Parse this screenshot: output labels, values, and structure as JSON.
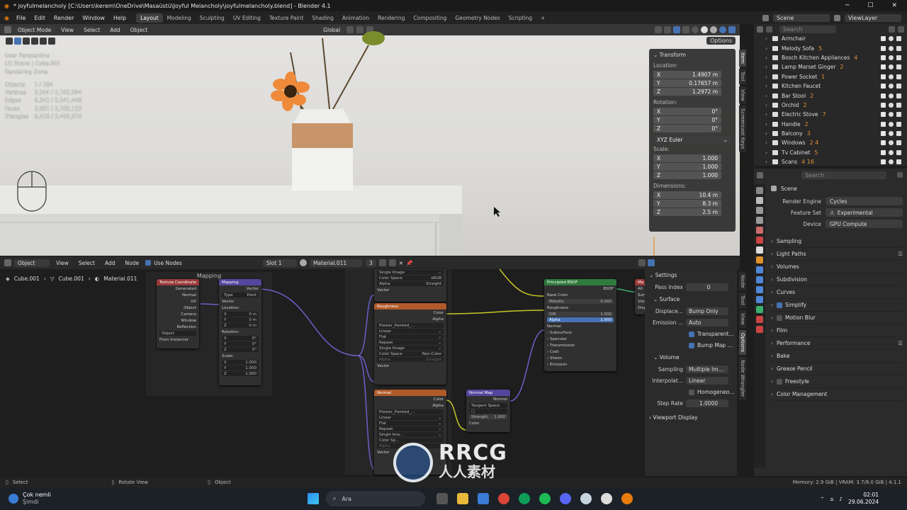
{
  "titlebar": {
    "title": "* joyfulmelancholy [C:\\Users\\kerem\\OneDrive\\Masaüstü\\Joyful Melancholy\\joyfulmelancholy.blend] - Blender 4.1"
  },
  "menubar": {
    "menus": [
      "File",
      "Edit",
      "Render",
      "Window",
      "Help"
    ],
    "workspaces": [
      "Layout",
      "Modeling",
      "Sculpting",
      "UV Editing",
      "Texture Paint",
      "Shading",
      "Animation",
      "Rendering",
      "Compositing",
      "Geometry Nodes",
      "Scripting"
    ],
    "active_workspace": "Layout",
    "add_tab": "+",
    "scene": "Scene",
    "view_layer": "ViewLayer"
  },
  "viewport": {
    "mode": "Object Mode",
    "menus": [
      "View",
      "Select",
      "Add",
      "Object"
    ],
    "orientation": "Global",
    "options": "Options",
    "info": {
      "perspective": "User Perspective",
      "collection": "(2) Scans | Cube.001",
      "status": "Rendering Done"
    },
    "stats": [
      {
        "label": "Objects",
        "value": "1 / 184"
      },
      {
        "label": "Vertices",
        "value": "3,244 / 2,782,094"
      },
      {
        "label": "Edges",
        "value": "6,342 / 5,541,448"
      },
      {
        "label": "Faces",
        "value": "3,097 / 2,765,125"
      },
      {
        "label": "Triangles",
        "value": "6,416 / 5,495,970"
      }
    ]
  },
  "npanel": {
    "title": "Transform",
    "location_label": "Location:",
    "location": [
      {
        "axis": "X",
        "value": "1.4907 m"
      },
      {
        "axis": "Y",
        "value": "0.17657 m"
      },
      {
        "axis": "Z",
        "value": "1.2972 m"
      }
    ],
    "rotation_label": "Rotation:",
    "rotation": [
      {
        "axis": "X",
        "value": "0°"
      },
      {
        "axis": "Y",
        "value": "0°"
      },
      {
        "axis": "Z",
        "value": "0°"
      }
    ],
    "rotation_mode": "XYZ Euler",
    "scale_label": "Scale:",
    "scale": [
      {
        "axis": "X",
        "value": "1.000"
      },
      {
        "axis": "Y",
        "value": "1.000"
      },
      {
        "axis": "Z",
        "value": "1.000"
      }
    ],
    "dimensions_label": "Dimensions:",
    "dimensions": [
      {
        "axis": "X",
        "value": "10.4 m"
      },
      {
        "axis": "Y",
        "value": "8.3 m"
      },
      {
        "axis": "Z",
        "value": "2.5 m"
      }
    ],
    "tabs": [
      "Item",
      "Tool",
      "View",
      "Screencast Keys"
    ]
  },
  "outliner": {
    "search_placeholder": "Search",
    "items": [
      {
        "name": "Armchair"
      },
      {
        "name": "Melody Sofa",
        "badge": "5"
      },
      {
        "name": "Bosch Kitchen Appliances",
        "badge": "4"
      },
      {
        "name": "Lamp Marset Ginger",
        "badge": "2"
      },
      {
        "name": "Power Socket",
        "badge": "1"
      },
      {
        "name": "Kitchen Faucet",
        "badge": ""
      },
      {
        "name": "Bar Stool",
        "badge": "2"
      },
      {
        "name": "Orchid",
        "badge": "2"
      },
      {
        "name": "Electric Stove",
        "badge": "7"
      },
      {
        "name": "Handle",
        "badge": "2"
      },
      {
        "name": "Balcony",
        "badge": "3"
      },
      {
        "name": "Windows",
        "badge": "2 4"
      },
      {
        "name": "Tv Cabinet",
        "badge": "5"
      },
      {
        "name": "Scans",
        "badge": "4 16"
      }
    ]
  },
  "properties": {
    "search_placeholder": "Search",
    "context": "Scene",
    "render_engine_label": "Render Engine",
    "render_engine": "Cycles",
    "feature_set_label": "Feature Set",
    "feature_set": "Experimental",
    "device_label": "Device",
    "device": "GPU Compute",
    "sections": [
      "Sampling",
      "Light Paths",
      "Volumes",
      "Subdivision",
      "Curves",
      "Simplify",
      "Motion Blur",
      "Film",
      "Performance",
      "Bake",
      "Grease Pencil",
      "Freestyle",
      "Color Management"
    ]
  },
  "node_editor": {
    "mode": "Object",
    "menus": [
      "View",
      "Select",
      "Add",
      "Node"
    ],
    "use_nodes": "Use Nodes",
    "slot": "Slot 1",
    "material": "Material.011",
    "users": "3",
    "breadcrumb": [
      "Cube.001",
      "Cube.001",
      "Material.011"
    ],
    "frame_label": "Mapping",
    "nodes": {
      "texcoord": {
        "title": "Texture Coordinate",
        "outputs": [
          "Generated",
          "Normal",
          "UV",
          "Object",
          "Camera",
          "Window",
          "Reflection"
        ],
        "object_label": "Object",
        "from_instancer": "From Instancer"
      },
      "mapping": {
        "title": "Mapping",
        "out": "Vector",
        "type_label": "Type",
        "type": "Point",
        "vector": "Vector",
        "location": "Location:",
        "loc": [
          "0 m",
          "0 m",
          "0 m"
        ],
        "rotation": "Rotation:",
        "rot": [
          "0°",
          "0°",
          "0°"
        ],
        "scale": "Scale:",
        "scl": [
          "1.000",
          "1.000",
          "1.000"
        ]
      },
      "img_top": {
        "rows": [
          "Single Image",
          "Color Space",
          "sRGB",
          "Alpha",
          "Straight",
          "Vector"
        ]
      },
      "roughness": {
        "title": "Roughness",
        "color": "Color",
        "alpha": "Alpha",
        "image": "Plaster_Painted_...",
        "interp": "Linear",
        "proj": "Flat",
        "ext": "Repeat",
        "source": "Single Image",
        "cs_label": "Color Space",
        "cs": "Non-Color",
        "alpha_label": "Alpha",
        "alpha_val": "Straight",
        "vector": "Vector"
      },
      "normal": {
        "title": "Normal",
        "color": "Color",
        "alpha": "Alpha",
        "image": "Plaster_Painted_...",
        "interp": "Linear",
        "proj": "Flat",
        "ext": "Repeat",
        "source": "Single Ima...",
        "cs_label": "Color Sp...",
        "alpha_label": "Alpha",
        "vector": "Vector"
      },
      "normalmap": {
        "title": "Normal Map",
        "out": "Normal",
        "space": "Tangent Space",
        "strength_label": "Strength",
        "strength": "1.000",
        "color": "Color"
      },
      "bsdf": {
        "title": "Principled BSDF",
        "out": "BSDF",
        "base_color": "Base Color",
        "metallic": "Metallic",
        "metallic_val": "0.000",
        "roughness": "Roughness",
        "ior": "IOR",
        "ior_val": "1.500",
        "alpha": "Alpha",
        "alpha_val": "1.000",
        "normal": "Normal",
        "subs": [
          "Subsurface",
          "Specular",
          "Transmission",
          "Coat",
          "Sheen",
          "Emission"
        ]
      },
      "output": {
        "title": "Ma",
        "rows": [
          "All",
          "Surfa",
          "Volu",
          "Displ"
        ]
      }
    }
  },
  "node_sidebar": {
    "title": "Settings",
    "pass_index_label": "Pass Index",
    "pass_index": "0",
    "surface": "Surface",
    "displacement_label": "Displace...",
    "displacement": "Bump Only",
    "emission_label": "Emission ...",
    "emission": "Auto",
    "transparent": "Transparent...",
    "bump_map": "Bump Map ...",
    "volume": "Volume",
    "sampling_label": "Sampling",
    "sampling": "Multiple Im...",
    "interp_label": "Interpolat...",
    "interp": "Linear",
    "homogeneous": "Homogeneo...",
    "step_rate_label": "Step Rate",
    "step_rate": "1.0000",
    "viewport_display": "Viewport Display",
    "tabs": [
      "Node",
      "Tool",
      "View",
      "Options",
      "Node Wrangler"
    ]
  },
  "statusbar": {
    "select": "Select",
    "rotate": "Rotate View",
    "object": "Object",
    "memory": "Memory: 2.9 GiB | VRAM: 3.7/8.0 GiB | 4.1.1"
  },
  "taskbar": {
    "weather": "Çok nemli",
    "weather_sub": "Şimdi",
    "search": "Ara",
    "time": "02:01",
    "date": "29.06.2024"
  },
  "watermark": {
    "brand": "RRCG",
    "sub": "人人素材"
  },
  "colors": {
    "accent": "#4772b3",
    "texture_node": "#9b3a3a",
    "image_node": "#b05a2a",
    "shader_node": "#2f7a3d",
    "vector_node": "#54469e",
    "link_yellow": "#c7c729",
    "link_purple": "#6b5fc7"
  }
}
